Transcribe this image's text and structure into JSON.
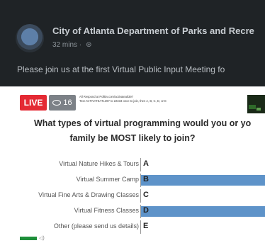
{
  "post": {
    "page_name": "City of Atlanta Department of Parks and Recre",
    "time": "32 mins ·",
    "text": "Please join us at the first Virtual Public Input Meeting fo"
  },
  "video": {
    "live_label": "LIVE",
    "viewer_count": "16",
    "instruction_line1": "All Respond at PollEv.com/activatealt397",
    "instruction_line2": "Text ACTIVATEATL397 to 22333 once to join, then A, B, C, D, or E",
    "question_line1": "What types of virtual programming would you or yo",
    "question_line2": "family be MOST likely to join?",
    "options": [
      {
        "label": "Virtual Nature Hikes & Tours",
        "letter": "A",
        "share": 0.0
      },
      {
        "label": "Virtual Summer Camp",
        "letter": "B",
        "share": 1.0
      },
      {
        "label": "Virtual Fine Arts & Drawing Classes",
        "letter": "C",
        "share": 0.0
      },
      {
        "label": "Virtual Fitness Classes",
        "letter": "D",
        "share": 1.0
      },
      {
        "label": "Other (please send us details)",
        "letter": "E",
        "share": 0.0
      }
    ],
    "bar_color": "#5e93c9",
    "live_color": "#e42a34"
  }
}
